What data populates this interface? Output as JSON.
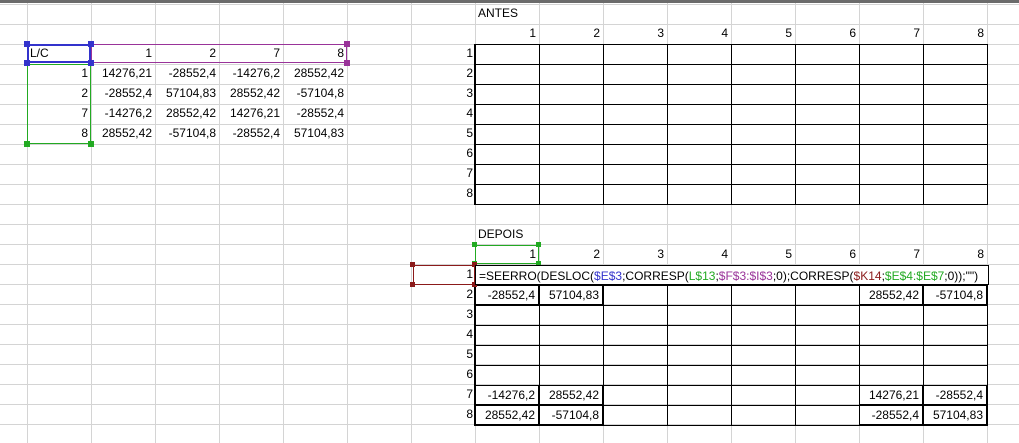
{
  "colors": {
    "blue_range": "#3333cc",
    "purple_range": "#993399",
    "green_range": "#22aa22",
    "darkred_range": "#8b1a1a"
  },
  "left_table": {
    "corner": "L/C",
    "col_headers": [
      "1",
      "2",
      "7",
      "8"
    ],
    "row_headers": [
      "1",
      "2",
      "7",
      "8"
    ],
    "rows": [
      [
        "14276,21",
        "-28552,4",
        "-14276,2",
        "28552,42"
      ],
      [
        "-28552,4",
        "57104,83",
        "28552,42",
        "-57104,8"
      ],
      [
        "-14276,2",
        "28552,42",
        "14276,21",
        "-28552,4"
      ],
      [
        "28552,42",
        "-57104,8",
        "-28552,4",
        "57104,83"
      ]
    ]
  },
  "antes": {
    "title": "ANTES",
    "col_headers": [
      "1",
      "2",
      "3",
      "4",
      "5",
      "6",
      "7",
      "8"
    ],
    "row_headers": [
      "1",
      "2",
      "3",
      "4",
      "5",
      "6",
      "7",
      "8"
    ]
  },
  "depois": {
    "title": "DEPOIS",
    "col_headers": [
      "1",
      "2",
      "3",
      "4",
      "5",
      "6",
      "7",
      "8"
    ],
    "row_headers": [
      "1",
      "2",
      "3",
      "4",
      "5",
      "6",
      "7",
      "8"
    ],
    "formula_parts": [
      {
        "text": "=SEERRO(DESLOC(",
        "color": "#000000"
      },
      {
        "text": "$E$3",
        "color": "#3333cc"
      },
      {
        "text": ";CORRESP(",
        "color": "#000000"
      },
      {
        "text": "L$13",
        "color": "#22aa22"
      },
      {
        "text": ";",
        "color": "#000000"
      },
      {
        "text": "$F$3:$I$3",
        "color": "#993399"
      },
      {
        "text": ";0);CORRESP(",
        "color": "#000000"
      },
      {
        "text": "$K14",
        "color": "#8b1a1a"
      },
      {
        "text": ";",
        "color": "#000000"
      },
      {
        "text": "$E$4:$E$7",
        "color": "#22aa22"
      },
      {
        "text": ";0));\"\")",
        "color": "#000000"
      }
    ],
    "rows": [
      [
        "",
        "",
        "",
        "",
        "",
        "",
        "",
        ""
      ],
      [
        "-28552,4",
        "57104,83",
        "",
        "",
        "",
        "",
        "28552,42",
        "-57104,8"
      ],
      [
        "",
        "",
        "",
        "",
        "",
        "",
        "",
        ""
      ],
      [
        "",
        "",
        "",
        "",
        "",
        "",
        "",
        ""
      ],
      [
        "",
        "",
        "",
        "",
        "",
        "",
        "",
        ""
      ],
      [
        "",
        "",
        "",
        "",
        "",
        "",
        "",
        ""
      ],
      [
        "-14276,2",
        "28552,42",
        "",
        "",
        "",
        "",
        "14276,21",
        "-28552,4"
      ],
      [
        "28552,42",
        "-57104,8",
        "",
        "",
        "",
        "",
        "-28552,4",
        "57104,83"
      ]
    ]
  }
}
